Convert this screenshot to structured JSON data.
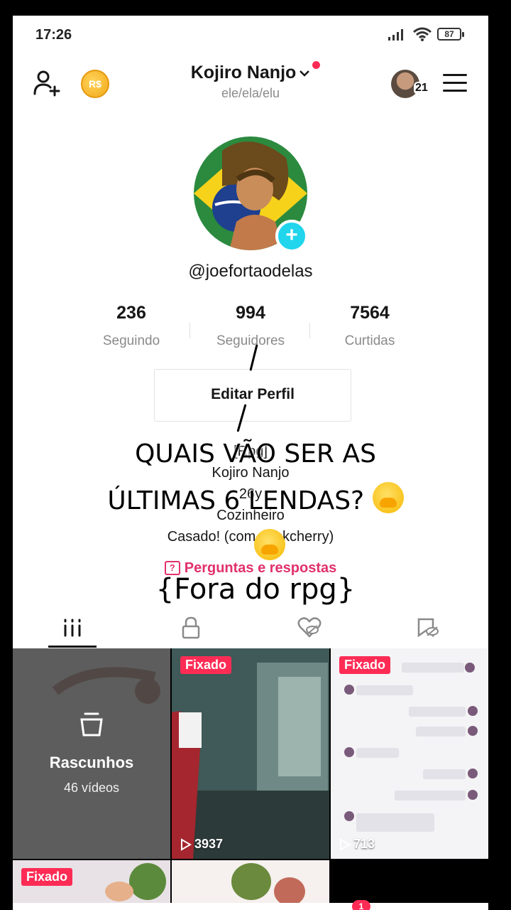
{
  "status_bar": {
    "time": "17:26",
    "battery": "87"
  },
  "header": {
    "display_name": "Kojiro Nanjo",
    "pronouns": "ele/ela/elu",
    "coin_label": "R$",
    "friends_count": "21"
  },
  "profile": {
    "username": "@joefortaodelas"
  },
  "stats": [
    {
      "value": "236",
      "label": "Seguindo"
    },
    {
      "value": "994",
      "label": "Seguidores"
    },
    {
      "value": "7564",
      "label": "Curtidas"
    }
  ],
  "edit_button": "Editar Perfil",
  "bio": {
    "line1": "[Rpg]",
    "line2": "Kojiro Nanjo",
    "line3": "26y",
    "line4": "Cozinheiro",
    "line5": "Casado! (com o_skcherry)"
  },
  "qa_link": "Perguntas e respostas",
  "tabs": [
    {
      "icon": "grid-icon"
    },
    {
      "icon": "lock-icon"
    },
    {
      "icon": "liked-hidden-icon"
    },
    {
      "icon": "bookmark-hidden-icon"
    }
  ],
  "grid": {
    "drafts_label": "Rascunhos",
    "drafts_count": "46 vídeos",
    "pinned_label": "Fixado",
    "video1_views": "3937",
    "video2_views": "713"
  },
  "overlay": {
    "line1": "QUAIS VÃO SER AS",
    "line2": "ÚLTIMAS 6 LENDAS?",
    "line3": "{Fora do rpg}"
  },
  "nav": {
    "inbox_badge": "1"
  },
  "colors": {
    "accent": "#fe2c55",
    "teal": "#20d5ec",
    "qa_pink": "#e1306c"
  }
}
